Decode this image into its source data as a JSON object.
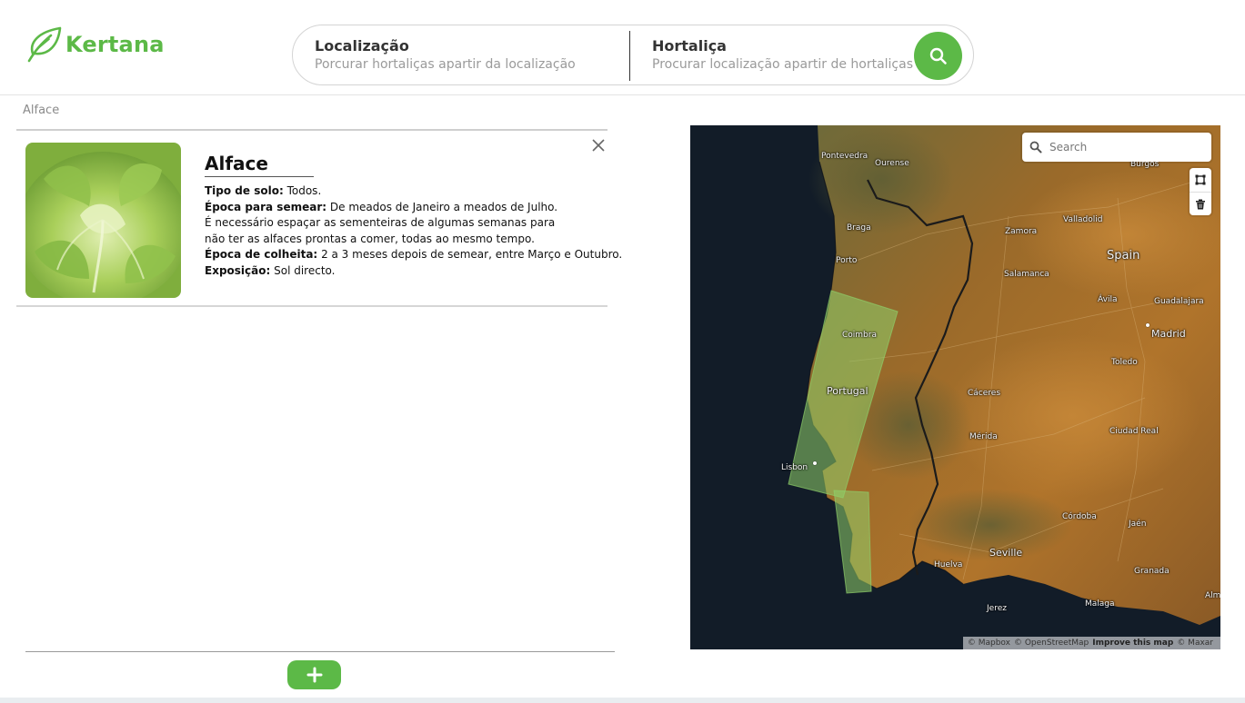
{
  "brand": {
    "name": "Kertana",
    "color": "#5cb947"
  },
  "search": {
    "location": {
      "title": "Localização",
      "subtitle": "Porcurar hortaliças apartir da localização"
    },
    "vegetable": {
      "title": "Hortaliça",
      "subtitle": "Procurar localização apartir de hortaliças"
    },
    "button_icon": "search-icon"
  },
  "breadcrumb": "Alface",
  "result": {
    "title": "Alface",
    "image_icon": "lettuce-photo",
    "close_icon": "close-icon",
    "fields": {
      "soil_label": "Tipo de solo:",
      "soil_value": "Todos.",
      "sowing_label": "Época para semear:",
      "sowing_value": "De meados de Janeiro a meados de Julho.",
      "sowing_note_1": "É necessário espaçar as sementeiras de algumas semanas para",
      "sowing_note_2": "não ter as alfaces prontas a comer, todas ao mesmo tempo.",
      "harvest_label": "Época de colheita:",
      "harvest_value": "2 a 3 meses depois de semear, entre Março e Outubro.",
      "exposure_label": "Exposição:",
      "exposure_value": "Sol directo."
    }
  },
  "add_button": {
    "label": "+"
  },
  "map": {
    "search_placeholder": "Search",
    "tools": [
      "polygon-draw-icon",
      "trash-icon"
    ],
    "labels": {
      "pontevedra": "Pontevedra",
      "ourense": "Ourense",
      "burgos": "Burgos",
      "braga": "Braga",
      "porto": "Porto",
      "zamora": "Zamora",
      "valladolid": "Valladolid",
      "spain": "Spain",
      "salamanca": "Salamanca",
      "avila": "Ávila",
      "guadalajara": "Guadalajara",
      "coimbra": "Coimbra",
      "madrid": "Madrid",
      "toledo": "Toledo",
      "portugal": "Portugal",
      "caceres": "Cáceres",
      "merida": "Mérida",
      "ciudad_real": "Ciudad Real",
      "lisbon": "Lisbon",
      "cordoba": "Córdoba",
      "jaen": "Jaén",
      "seville": "Seville",
      "huelva": "Huelva",
      "granada": "Granada",
      "jerez": "Jerez",
      "malaga": "Malaga",
      "almeria": "Alm"
    },
    "attribution": {
      "mapbox": "© Mapbox",
      "osm": "© OpenStreetMap",
      "improve": "Improve this map",
      "maxar": "© Maxar"
    }
  }
}
